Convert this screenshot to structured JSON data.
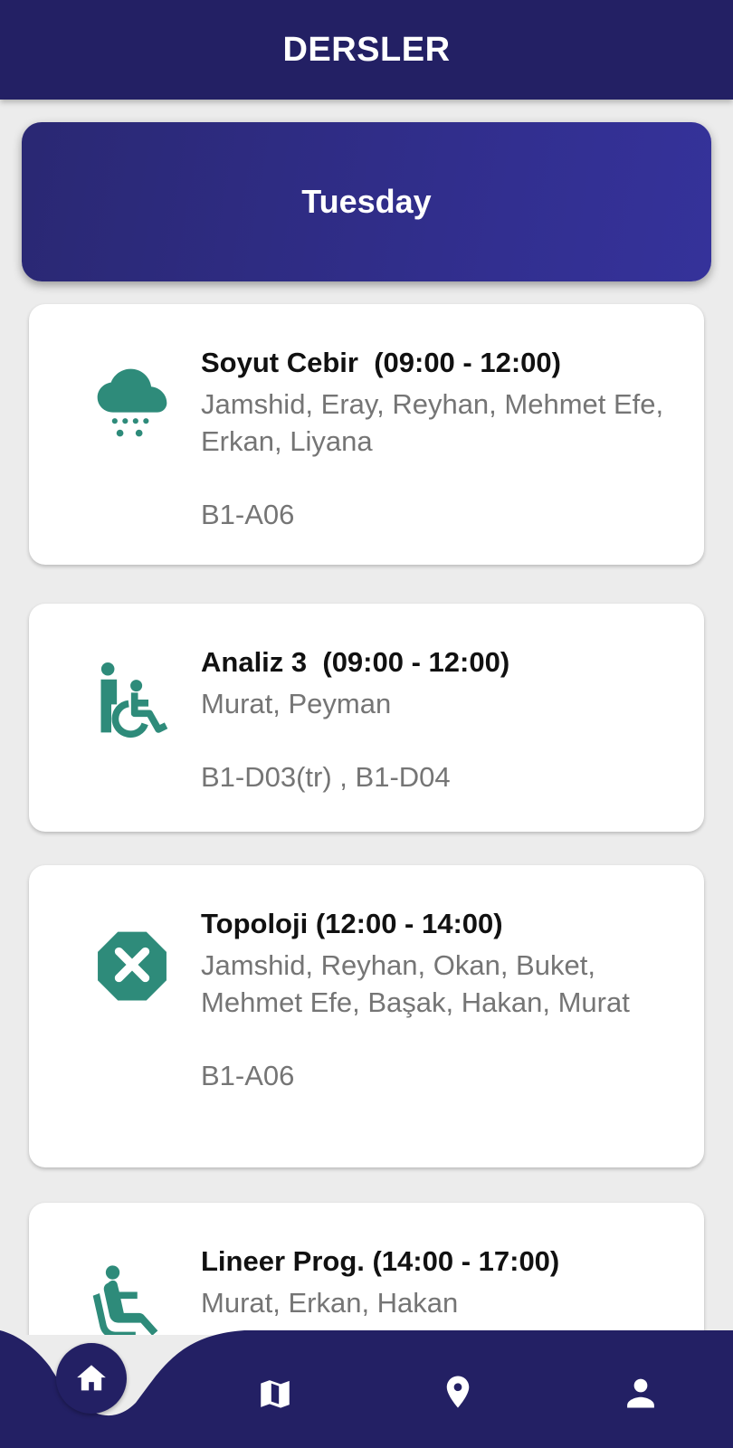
{
  "app_bar": {
    "title": "DERSLER"
  },
  "day": {
    "label": "Tuesday"
  },
  "colors": {
    "primary": "#232064",
    "banner": "#322f90",
    "icon_teal": "#2e8b7a",
    "text_secondary": "#757575"
  },
  "courses": [
    {
      "icon": "snow-cloud-icon",
      "title": "Soyut Cebir  (09:00 - 12:00)",
      "people": "Jamshid, Eray, Reyhan, Mehmet Efe, Erkan, Liyana",
      "room": "B1-A06"
    },
    {
      "icon": "accessible-icon",
      "title": "Analiz 3  (09:00 - 12:00)",
      "people": "Murat, Peyman",
      "room": "B1-D03(tr) , B1-D04"
    },
    {
      "icon": "cancel-octagon-icon",
      "title": "Topoloji (12:00 - 14:00)",
      "people": "Jamshid, Reyhan, Okan, Buket, Mehmet Efe, Başak, Hakan, Murat",
      "room": "B1-A06"
    },
    {
      "icon": "seated-person-icon",
      "title": "Lineer Prog. (14:00 - 17:00)",
      "people": "Murat, Erkan, Hakan",
      "room": ""
    }
  ],
  "nav": {
    "items": [
      {
        "icon": "home-icon",
        "active": true
      },
      {
        "icon": "map-icon",
        "active": false
      },
      {
        "icon": "location-pin-icon",
        "active": false
      },
      {
        "icon": "person-icon",
        "active": false
      }
    ]
  }
}
